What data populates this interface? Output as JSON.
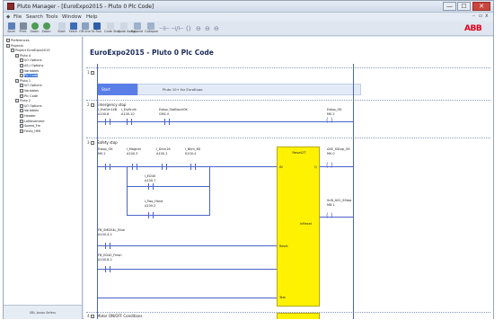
{
  "window": {
    "title": "Pluto Manager - [EuroExpo2015 - Pluto 0 Plc Code]",
    "controls": {
      "minimize": "—",
      "maximize": "☐",
      "close": "✕"
    }
  },
  "menu": {
    "items": [
      "File",
      "Search",
      "Tools",
      "Window",
      "Help"
    ],
    "mdi_buttons": [
      "–",
      "▫",
      "x"
    ]
  },
  "toolbar": {
    "buttons": [
      "Save",
      "Print",
      "Zoom",
      "Zoom",
      "Start",
      "Fetch",
      "Off-line",
      "To Run",
      "Code Stop",
      "Code Assign",
      "Expand",
      "Collapse"
    ],
    "brand": "ABB"
  },
  "tree": {
    "items": [
      {
        "label": "Preferences",
        "depth": 1
      },
      {
        "label": "Projects",
        "depth": 1
      },
      {
        "label": "Project EuroExpo2015",
        "depth": 2
      },
      {
        "label": "Pluto A",
        "depth": 3
      },
      {
        "label": "I/O Options",
        "depth": 4
      },
      {
        "label": "AS-i Options",
        "depth": 4
      },
      {
        "label": "Variables",
        "depth": 4
      },
      {
        "label": "Plc Code",
        "depth": 4,
        "selected": true
      },
      {
        "label": "Pluto 1",
        "depth": 3
      },
      {
        "label": "I/O Options",
        "depth": 4
      },
      {
        "label": "Variables",
        "depth": 4
      },
      {
        "label": "Plc Code",
        "depth": 4
      },
      {
        "label": "Pluto 2",
        "depth": 3
      },
      {
        "label": "I/O Options",
        "depth": 4
      },
      {
        "label": "Variables",
        "depth": 4
      },
      {
        "label": "Header",
        "depth": 4
      },
      {
        "label": "LoMovement",
        "depth": 4
      },
      {
        "label": "Speed_Fm",
        "depth": 4
      },
      {
        "label": "Fmax_HMI",
        "depth": 4
      }
    ],
    "footer": "SBL Jonas Sefers"
  },
  "editor": {
    "title": "EuroExpo2015 - Pluto 0 Plc Code",
    "nets": [
      {
        "num": "1",
        "comment": ""
      },
      {
        "num": "2",
        "comment": "Emergency stop"
      },
      {
        "num": "3",
        "comment": "Safety stop"
      },
      {
        "num": "4",
        "comment": "Motor ON/OFF Conditions"
      }
    ],
    "start": {
      "label": "Start",
      "comment": "Pluto 10+ for EuroExpo"
    },
    "net2": {
      "c1": {
        "name": "I_EstGrn1kB",
        "addr": "A100.8"
      },
      "c2": {
        "name": "I_EstSnrlk",
        "addr": "A100.10"
      },
      "c3": {
        "name": "Estop_StaBlockOK",
        "addr": "GM1.0"
      },
      "coil": {
        "name": "Estop_OK",
        "addr": "M0.2"
      }
    },
    "net3": {
      "c1": {
        "name": "Estop_OK",
        "addr": "M0.2"
      },
      "c2": {
        "name": "I_Magnet",
        "addr": "A100.3"
      },
      "c3": {
        "name": "I_Dmn16",
        "addr": "A100.1"
      },
      "c4": {
        "name": "I_Nkm_KK",
        "addr": "K100.4"
      },
      "c5": {
        "name": "I_ED40",
        "addr": "A100.7"
      },
      "c6": {
        "name": "I_Two_Hand",
        "addr": "A100.2"
      },
      "c7": {
        "name": "FB_SMDS4L_Blue",
        "addr": "A100.4.2"
      },
      "c8": {
        "name": "FB_ED40_Fresh",
        "addr": "A100.8.2"
      },
      "fb": {
        "title": "Reset2T",
        "pins": {
          "in": "IN",
          "q": "Q",
          "inreset": "InReset",
          "reset": "Reset",
          "test": "Test"
        }
      },
      "out1": {
        "name": "AXE_SStop_OK",
        "addr": "M0.0"
      },
      "out2": {
        "name": "SnB_AS1_SStop",
        "addr": "M8.1"
      }
    }
  }
}
